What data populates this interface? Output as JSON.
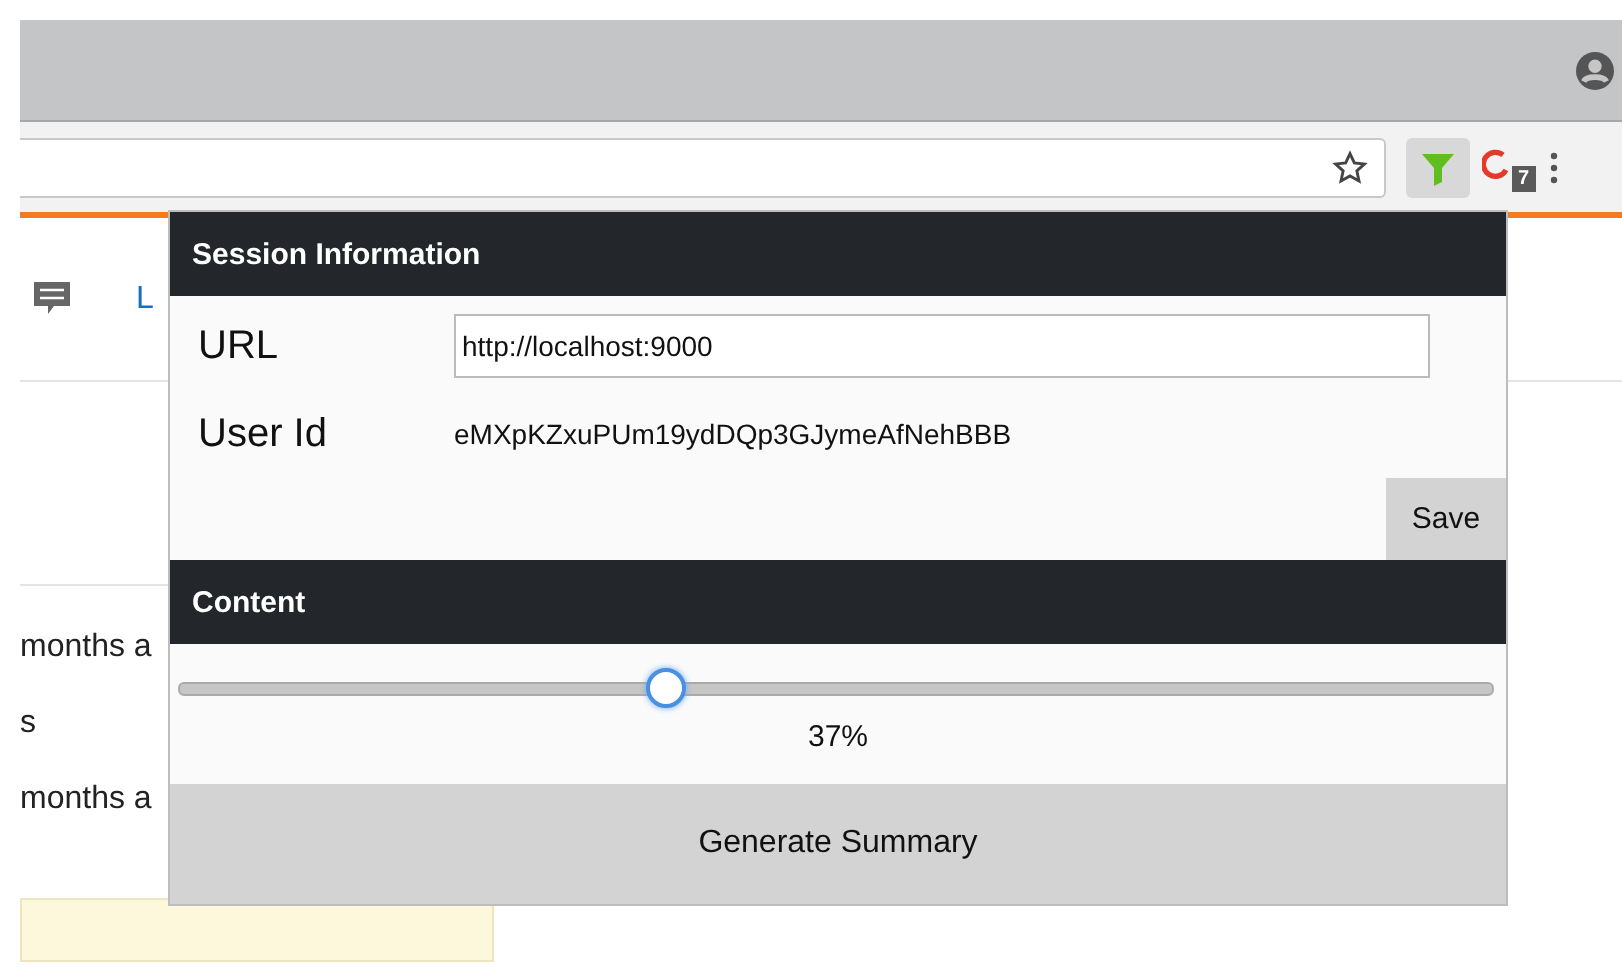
{
  "browser": {
    "extension_badge": "7"
  },
  "background_page": {
    "nav_link": "L",
    "lines": [
      "months a",
      "s",
      "months a"
    ]
  },
  "popup": {
    "session_title": "Session Information",
    "fields": [
      {
        "kind": "input",
        "label": "URL",
        "value": "http://localhost:9000"
      },
      {
        "kind": "text",
        "label": "User Id",
        "value": "eMXpKZxuPUm19ydDQp3GJymeAfNehBBB"
      }
    ],
    "save_button": "Save",
    "content_title": "Content",
    "slider": {
      "level": 0.37
    },
    "reading": "37%",
    "generate_button": "Generate Summary"
  }
}
